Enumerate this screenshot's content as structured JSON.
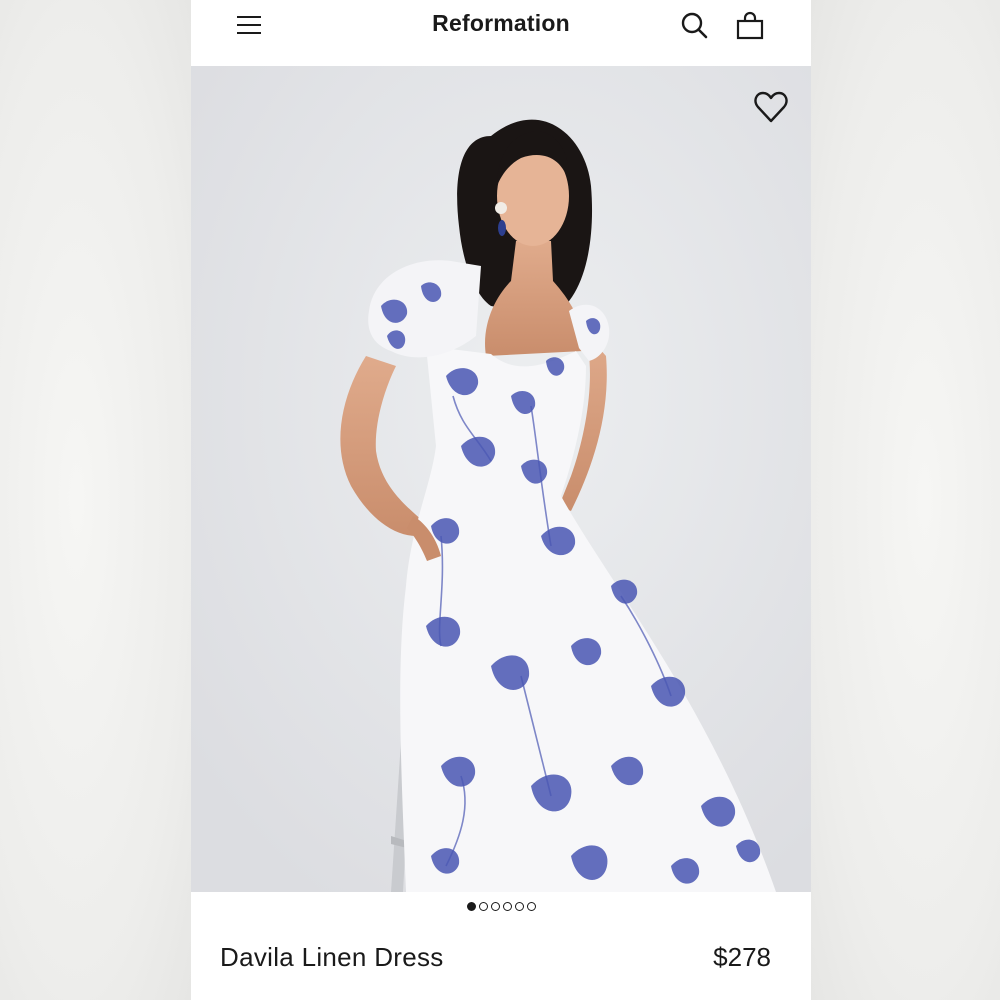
{
  "header": {
    "brand": "Reformation",
    "icons": [
      "menu-icon",
      "search-icon",
      "bag-icon"
    ]
  },
  "product": {
    "name": "Davila Linen Dress",
    "price": "$278",
    "image_alt": "Woman wearing white linen dress with blue floral print, puff sleeves, seated on a stool",
    "image_count": 6,
    "active_image_index": 0
  },
  "colors": {
    "text": "#1a1a1a",
    "print_blue": "#4a57b3",
    "background": "#e5e6e8"
  }
}
